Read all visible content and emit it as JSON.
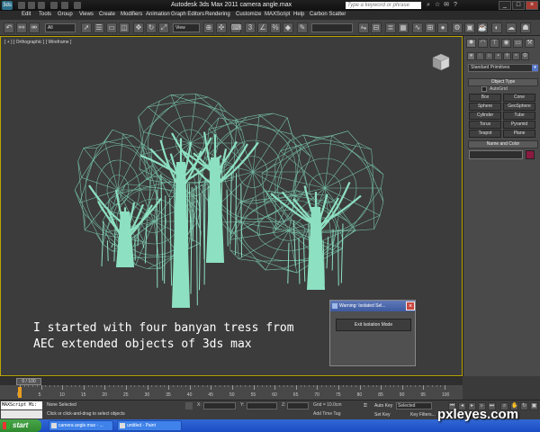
{
  "window": {
    "title": "Autodesk 3ds Max  2011     camera angle.max",
    "search_placeholder": "Type a keyword or phrase",
    "app_logo": "3ds",
    "window_buttons": [
      "_",
      "□",
      "×"
    ]
  },
  "menu": [
    "Edit",
    "Tools",
    "Group",
    "Views",
    "Create",
    "Modifiers",
    "Animation",
    "Graph Editors",
    "Rendering",
    "Customize",
    "MAXScript",
    "Help",
    "Carbon Scatter"
  ],
  "toolbar": {
    "selection_filter": "All",
    "reference_coord": "View"
  },
  "viewport": {
    "label": "[ + ] [ Orthographic ] [ Wireframe ]",
    "caption_line1": "I started with four banyan tress from",
    "caption_line2": "AEC extended objects of 3ds max",
    "wire_color": "#7ed3b8"
  },
  "dialog": {
    "title": "Warning: Isolated Sel...",
    "button": "Exit Isolation Mode",
    "close": "×"
  },
  "command_panel": {
    "category": "Standard Primitives",
    "object_type_header": "Object Type",
    "autogrid": "AutoGrid",
    "object_buttons": [
      "Box",
      "Cone",
      "Sphere",
      "GeoSphere",
      "Cylinder",
      "Tube",
      "Torus",
      "Pyramid",
      "Teapot",
      "Plane"
    ],
    "name_color_header": "Name and Color",
    "swatch_color": "#8a1a40"
  },
  "timeline": {
    "frame_display": "0 / 100",
    "ticks": [
      "0",
      "5",
      "10",
      "15",
      "20",
      "25",
      "30",
      "35",
      "40",
      "45",
      "50",
      "55",
      "60",
      "65",
      "70",
      "75",
      "80",
      "85",
      "90",
      "95",
      "100"
    ]
  },
  "status": {
    "maxscript": "MAXScript Mi:",
    "selection": "None Selected",
    "prompt": "Click or click-and-drag to select objects",
    "x_label": "X:",
    "y_label": "Y:",
    "z_label": "Z:",
    "grid": "Grid = 10.0cm",
    "add_time_tag": "Add Time Tag",
    "auto_key": "Auto Key",
    "set_key": "Set Key",
    "key_filters": "Key Filters...",
    "selected": "Selected"
  },
  "taskbar": {
    "start": "start",
    "tasks": [
      "camera angle.max - ...",
      "untitled - Paint"
    ]
  },
  "watermark": "pxleyes.com"
}
